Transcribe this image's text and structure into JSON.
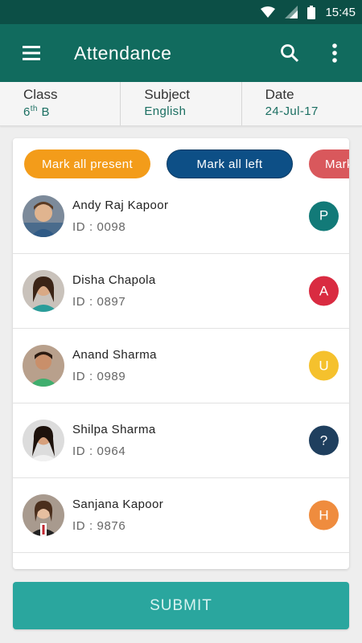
{
  "status_bar": {
    "time": "15:45",
    "icons": [
      "wifi-icon",
      "signal-icon",
      "battery-icon"
    ]
  },
  "app_bar": {
    "title": "Attendance",
    "icons": [
      "menu-icon",
      "search-icon",
      "more-vert-icon"
    ],
    "color": "#116b5e"
  },
  "info": {
    "class_label": "Class",
    "class_value": "6",
    "class_suffix": "th",
    "class_section": " B",
    "subject_label": "Subject",
    "subject_value": "English",
    "date_label": "Date",
    "date_value": "24-Jul-17"
  },
  "chips": [
    {
      "label": "Mark all present",
      "color": "#f39c1a"
    },
    {
      "label": "Mark all left",
      "color": "#0d4f86"
    },
    {
      "label": "Mark",
      "color": "#d9585c"
    }
  ],
  "students": [
    {
      "name": "Andy Raj Kapoor",
      "id": "ID : 0098",
      "status": "P",
      "status_color": "#127a78"
    },
    {
      "name": "Disha Chapola",
      "id": "ID : 0897",
      "status": "A",
      "status_color": "#d92b41"
    },
    {
      "name": "Anand Sharma",
      "id": "ID : 0989",
      "status": "U",
      "status_color": "#f5c12d"
    },
    {
      "name": "Shilpa Sharma",
      "id": "ID : 0964",
      "status": "?",
      "status_color": "#1f3f5e"
    },
    {
      "name": "Sanjana Kapoor",
      "id": "ID : 9876",
      "status": "H",
      "status_color": "#ef8c3e"
    }
  ],
  "submit_label": "SUBMIT"
}
